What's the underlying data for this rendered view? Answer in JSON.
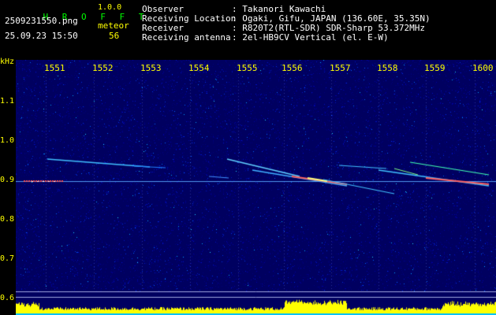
{
  "header": {
    "brand": "H R O F F T",
    "version": "1.0.0",
    "filename": "2509231550.png",
    "timestamp": "25.09.23 15:50",
    "meteor_label": "meteor",
    "meteor_count": "56",
    "info": [
      {
        "key": "Observer",
        "value": ": Takanori Kawachi"
      },
      {
        "key": "Receiving Location",
        "value": ": Ogaki, Gifu, JAPAN (136.60E, 35.35N)"
      },
      {
        "key": "Receiver",
        "value": ": R820T2(RTL-SDR) SDR-Sharp 53.372MHz"
      },
      {
        "key": "Receiving antenna",
        "value": ": 2el-HB9CV Vertical (el. E-W)"
      }
    ]
  },
  "axes": {
    "unit": "kHz",
    "y_ticks": [
      "1.1",
      "1.0",
      "0.9",
      "0.8",
      "0.7",
      "0.6"
    ],
    "x_ticks": [
      "1551",
      "1552",
      "1553",
      "1554",
      "1555",
      "1556",
      "1557",
      "1558",
      "1559",
      "1600"
    ]
  },
  "colors": {
    "background_noise": "#000080",
    "axis_text": "#ffff00",
    "brand": "#00ff00",
    "carrier_line": "#ff4040",
    "level_bar": "#ffff00",
    "level_baseline": "#00c0ff"
  }
}
